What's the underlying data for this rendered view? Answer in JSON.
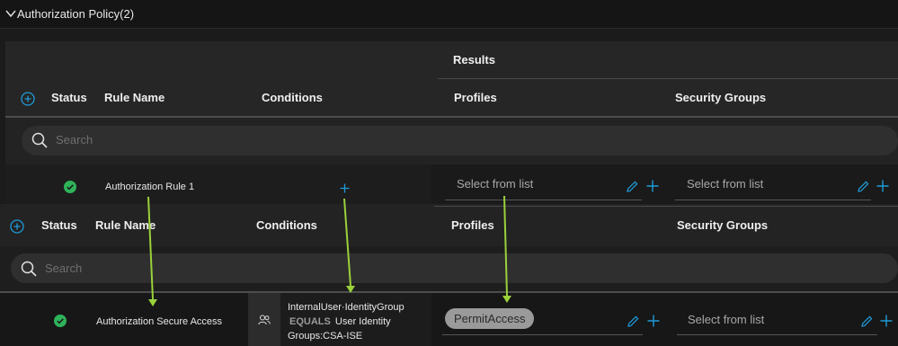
{
  "section": {
    "title": "Authorization Policy(2)"
  },
  "panel1": {
    "results_label": "Results",
    "columns": {
      "status": "Status",
      "rule_name": "Rule Name",
      "conditions": "Conditions",
      "profiles": "Profiles",
      "security_groups": "Security Groups"
    },
    "search_placeholder": "Search",
    "row": {
      "rule_name": "Authorization Rule 1",
      "profiles_placeholder": "Select from list",
      "security_groups_placeholder": "Select from list"
    }
  },
  "panel2": {
    "columns": {
      "status": "Status",
      "rule_name": "Rule Name",
      "conditions": "Conditions",
      "profiles": "Profiles",
      "security_groups": "Security Groups"
    },
    "search_placeholder": "Search",
    "row": {
      "rule_name": "Authorization Secure Access",
      "condition_line1": "InternalUser·IdentityGroup",
      "condition_operator": "EQUALS",
      "condition_value_part1": "User Identity",
      "condition_line3": "Groups:CSA-ISE",
      "profile_tag": "PermitAccess",
      "security_groups_placeholder": "Select from list"
    }
  },
  "colors": {
    "accent": "#1f9bd8",
    "status_green": "#2fb35a",
    "annotation_arrow": "#9ad13a"
  },
  "icons": {
    "collapse": "chevron-down-icon",
    "add_rule": "plus-circle-icon",
    "search": "search-icon",
    "status": "check-circle-icon",
    "edit": "pencil-icon",
    "add": "plus-icon",
    "identity_group": "users-icon"
  }
}
